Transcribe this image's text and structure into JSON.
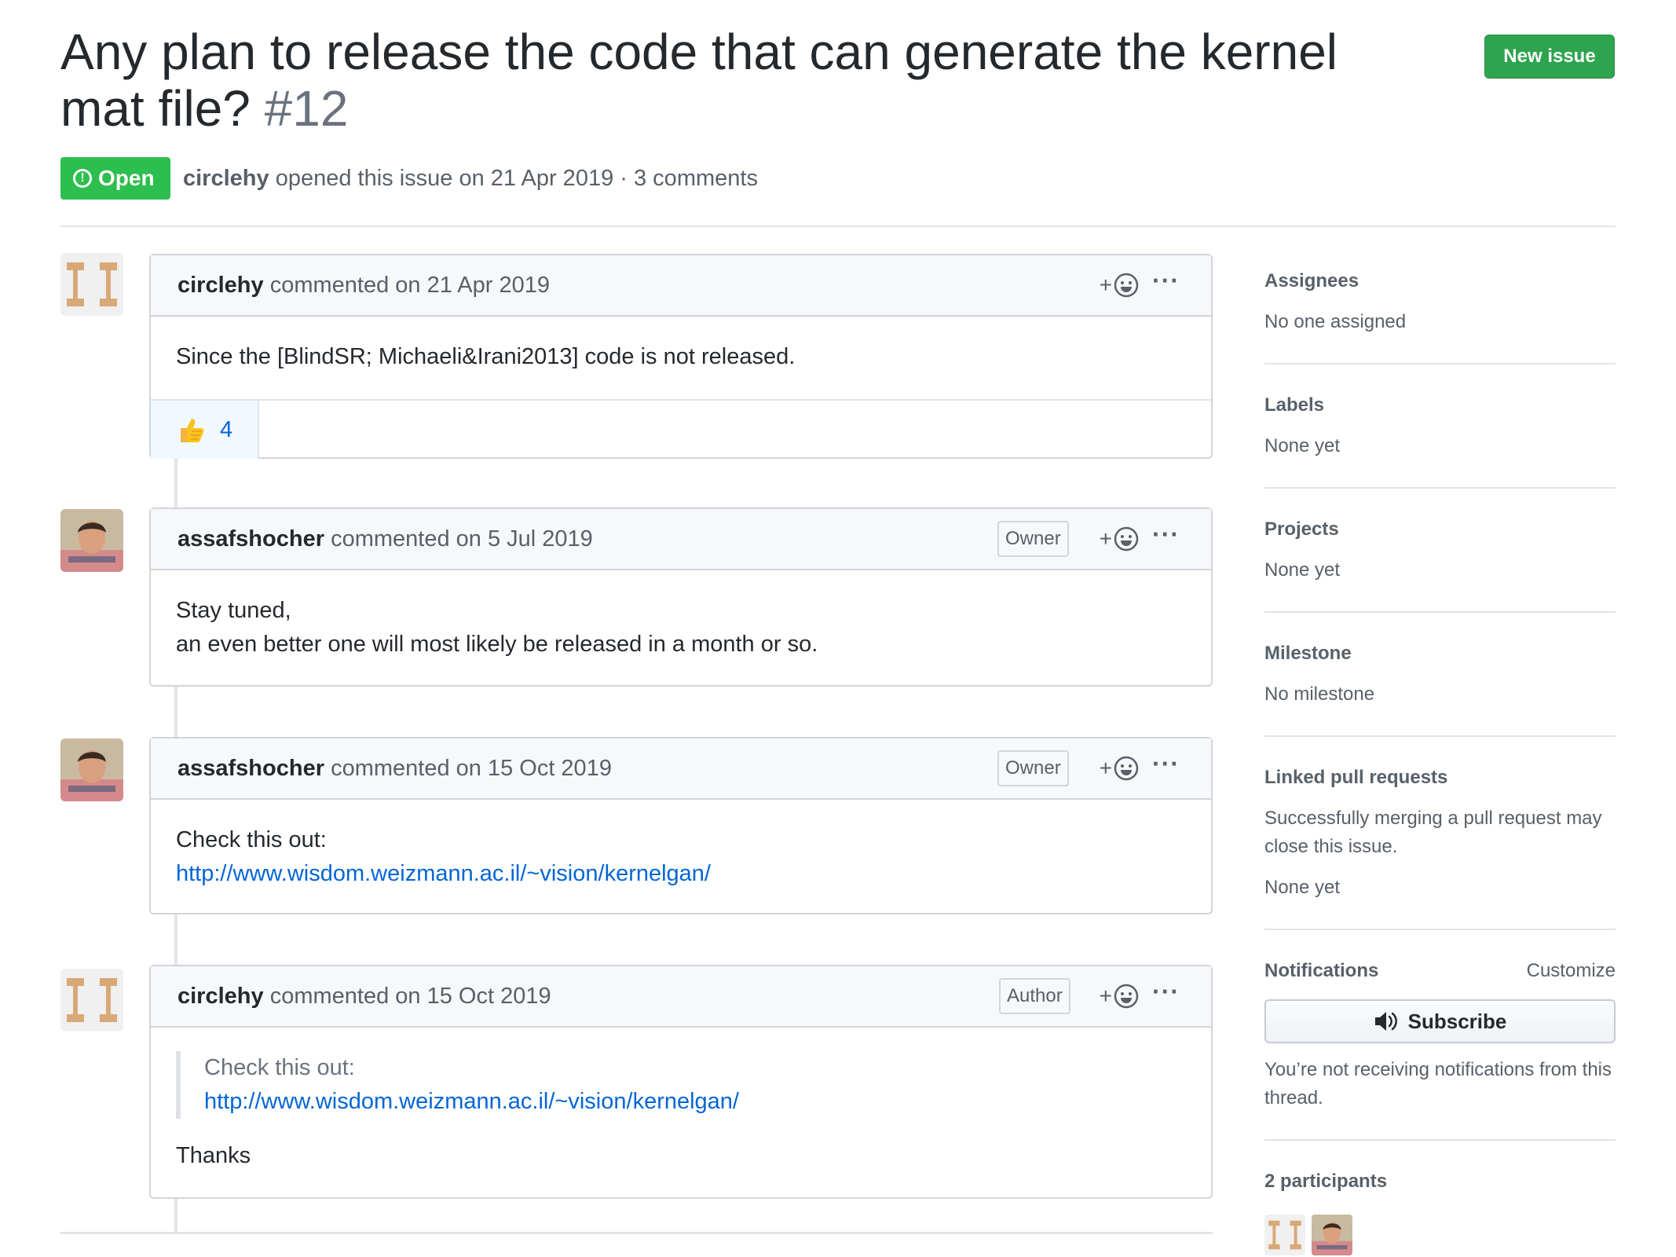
{
  "issue": {
    "title": "Any plan to release the code that can generate the kernel mat file?",
    "number": "#12",
    "state": "Open",
    "author": "circlehy",
    "opened_text": "opened this issue on 21 Apr 2019",
    "separator": "·",
    "comments_count": "3 comments",
    "new_issue_label": "New issue"
  },
  "comments": [
    {
      "author": "circlehy",
      "meta": "commented on 21 Apr 2019",
      "role": "",
      "body": "Since the [BlindSR; Michaeli&Irani2013] code is not released.",
      "reaction_count": "4"
    },
    {
      "author": "assafshocher",
      "meta": "commented on 5 Jul 2019",
      "role": "Owner",
      "body_line1": "Stay tuned,",
      "body_line2": "an even better one will most likely be released in a month or so."
    },
    {
      "author": "assafshocher",
      "meta": "commented on 15 Oct 2019",
      "role": "Owner",
      "body_line1": "Check this out:",
      "link": "http://www.wisdom.weizmann.ac.il/~vision/kernelgan/"
    },
    {
      "author": "circlehy",
      "meta": "commented on 15 Oct 2019",
      "role": "Author",
      "quote_line1": "Check this out:",
      "quote_link": "http://www.wisdom.weizmann.ac.il/~vision/kernelgan/",
      "body": "Thanks"
    }
  ],
  "sidebar": {
    "assignees_title": "Assignees",
    "assignees_value": "No one assigned",
    "labels_title": "Labels",
    "labels_value": "None yet",
    "projects_title": "Projects",
    "projects_value": "None yet",
    "milestone_title": "Milestone",
    "milestone_value": "No milestone",
    "linked_title": "Linked pull requests",
    "linked_desc": "Successfully merging a pull request may close this issue.",
    "linked_value": "None yet",
    "notifications_title": "Notifications",
    "customize_label": "Customize",
    "subscribe_label": "Subscribe",
    "notifications_desc": "You’re not receiving notifications from this thread.",
    "participants_title": "2 participants"
  },
  "colors": {
    "green": "#2cbe4e",
    "link": "#0366d6",
    "border": "#d1d5da"
  }
}
